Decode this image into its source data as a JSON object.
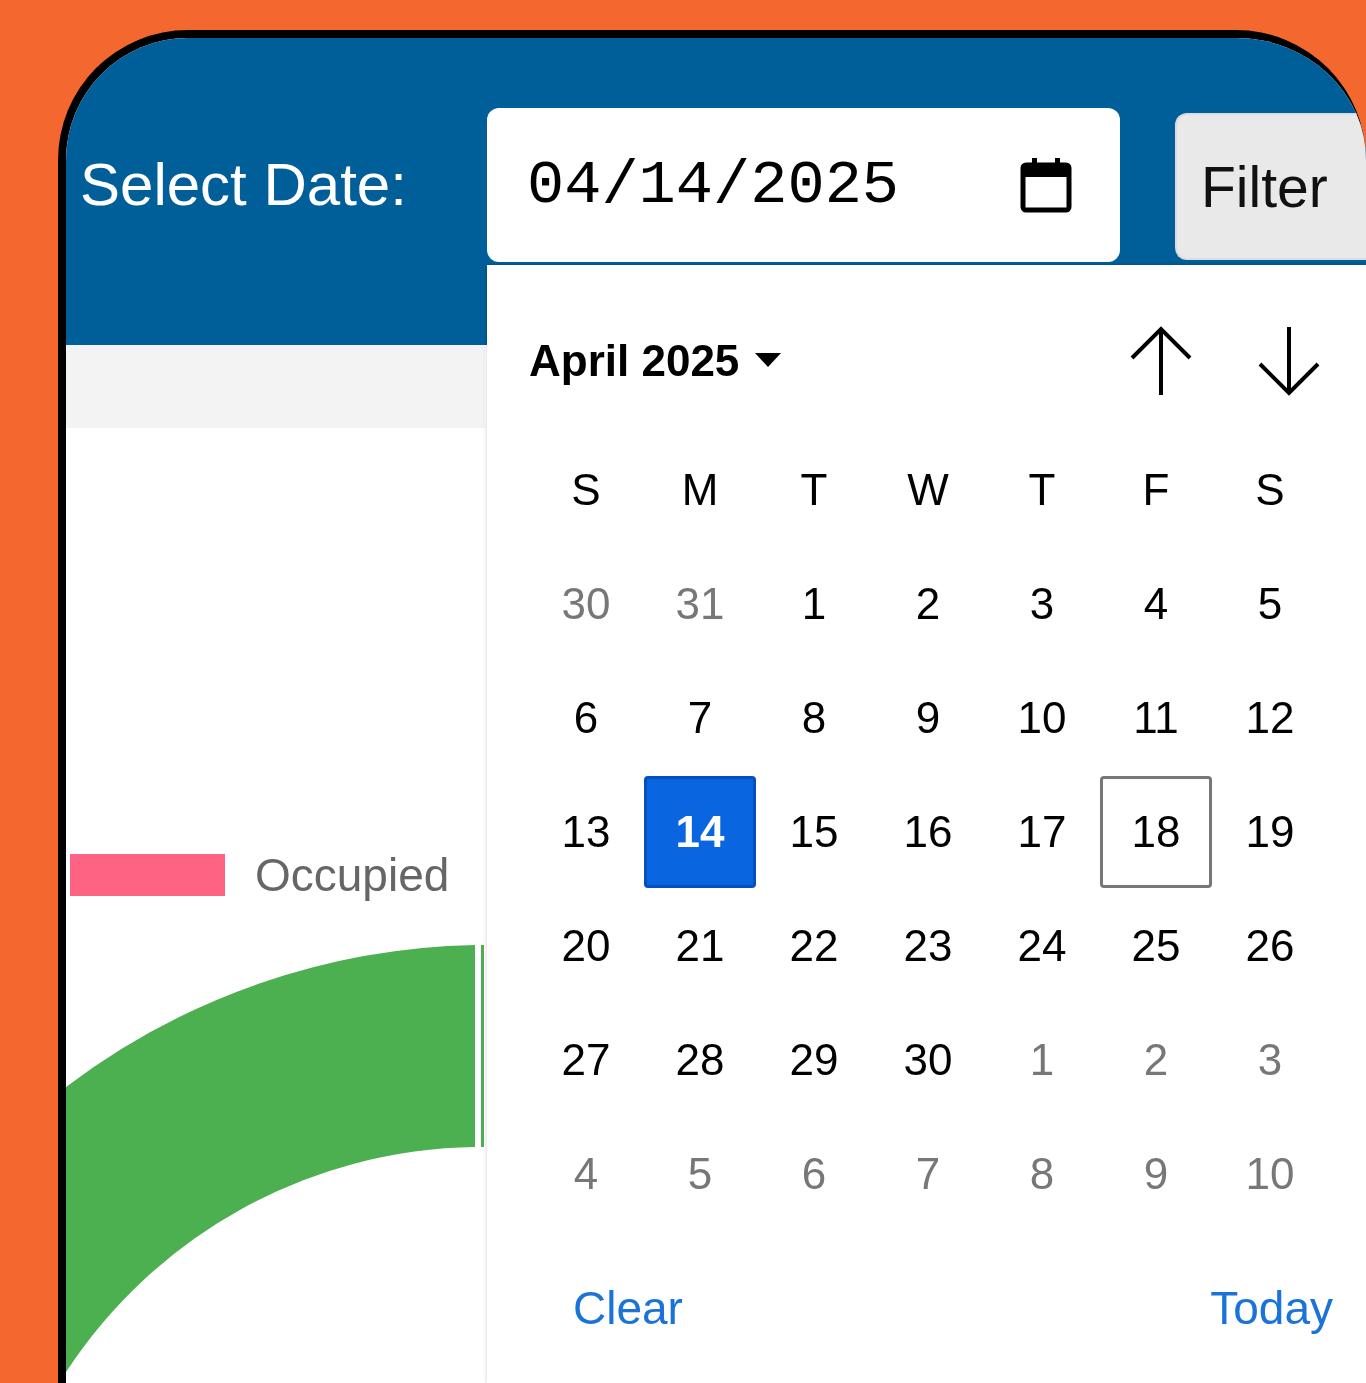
{
  "header": {
    "label": "Select Date:",
    "date_value": "04/14/2025",
    "filter_button": "Filter"
  },
  "legend": {
    "label": "Occupied",
    "color": "#ff6384"
  },
  "chart": {
    "kind": "donut"
  },
  "calendar": {
    "month_label": "April 2025",
    "weekdays": [
      "S",
      "M",
      "T",
      "W",
      "T",
      "F",
      "S"
    ],
    "days": [
      {
        "label": "30",
        "outside": true,
        "selected": false,
        "today": false
      },
      {
        "label": "31",
        "outside": true,
        "selected": false,
        "today": false
      },
      {
        "label": "1",
        "outside": false,
        "selected": false,
        "today": false
      },
      {
        "label": "2",
        "outside": false,
        "selected": false,
        "today": false
      },
      {
        "label": "3",
        "outside": false,
        "selected": false,
        "today": false
      },
      {
        "label": "4",
        "outside": false,
        "selected": false,
        "today": false
      },
      {
        "label": "5",
        "outside": false,
        "selected": false,
        "today": false
      },
      {
        "label": "6",
        "outside": false,
        "selected": false,
        "today": false
      },
      {
        "label": "7",
        "outside": false,
        "selected": false,
        "today": false
      },
      {
        "label": "8",
        "outside": false,
        "selected": false,
        "today": false
      },
      {
        "label": "9",
        "outside": false,
        "selected": false,
        "today": false
      },
      {
        "label": "10",
        "outside": false,
        "selected": false,
        "today": false
      },
      {
        "label": "11",
        "outside": false,
        "selected": false,
        "today": false
      },
      {
        "label": "12",
        "outside": false,
        "selected": false,
        "today": false
      },
      {
        "label": "13",
        "outside": false,
        "selected": false,
        "today": false
      },
      {
        "label": "14",
        "outside": false,
        "selected": true,
        "today": false
      },
      {
        "label": "15",
        "outside": false,
        "selected": false,
        "today": false
      },
      {
        "label": "16",
        "outside": false,
        "selected": false,
        "today": false
      },
      {
        "label": "17",
        "outside": false,
        "selected": false,
        "today": false
      },
      {
        "label": "18",
        "outside": false,
        "selected": false,
        "today": true
      },
      {
        "label": "19",
        "outside": false,
        "selected": false,
        "today": false
      },
      {
        "label": "20",
        "outside": false,
        "selected": false,
        "today": false
      },
      {
        "label": "21",
        "outside": false,
        "selected": false,
        "today": false
      },
      {
        "label": "22",
        "outside": false,
        "selected": false,
        "today": false
      },
      {
        "label": "23",
        "outside": false,
        "selected": false,
        "today": false
      },
      {
        "label": "24",
        "outside": false,
        "selected": false,
        "today": false
      },
      {
        "label": "25",
        "outside": false,
        "selected": false,
        "today": false
      },
      {
        "label": "26",
        "outside": false,
        "selected": false,
        "today": false
      },
      {
        "label": "27",
        "outside": false,
        "selected": false,
        "today": false
      },
      {
        "label": "28",
        "outside": false,
        "selected": false,
        "today": false
      },
      {
        "label": "29",
        "outside": false,
        "selected": false,
        "today": false
      },
      {
        "label": "30",
        "outside": false,
        "selected": false,
        "today": false
      },
      {
        "label": "1",
        "outside": true,
        "selected": false,
        "today": false
      },
      {
        "label": "2",
        "outside": true,
        "selected": false,
        "today": false
      },
      {
        "label": "3",
        "outside": true,
        "selected": false,
        "today": false
      },
      {
        "label": "4",
        "outside": true,
        "selected": false,
        "today": false
      },
      {
        "label": "5",
        "outside": true,
        "selected": false,
        "today": false
      },
      {
        "label": "6",
        "outside": true,
        "selected": false,
        "today": false
      },
      {
        "label": "7",
        "outside": true,
        "selected": false,
        "today": false
      },
      {
        "label": "8",
        "outside": true,
        "selected": false,
        "today": false
      },
      {
        "label": "9",
        "outside": true,
        "selected": false,
        "today": false
      },
      {
        "label": "10",
        "outside": true,
        "selected": false,
        "today": false
      }
    ],
    "clear_button": "Clear",
    "today_button": "Today"
  }
}
